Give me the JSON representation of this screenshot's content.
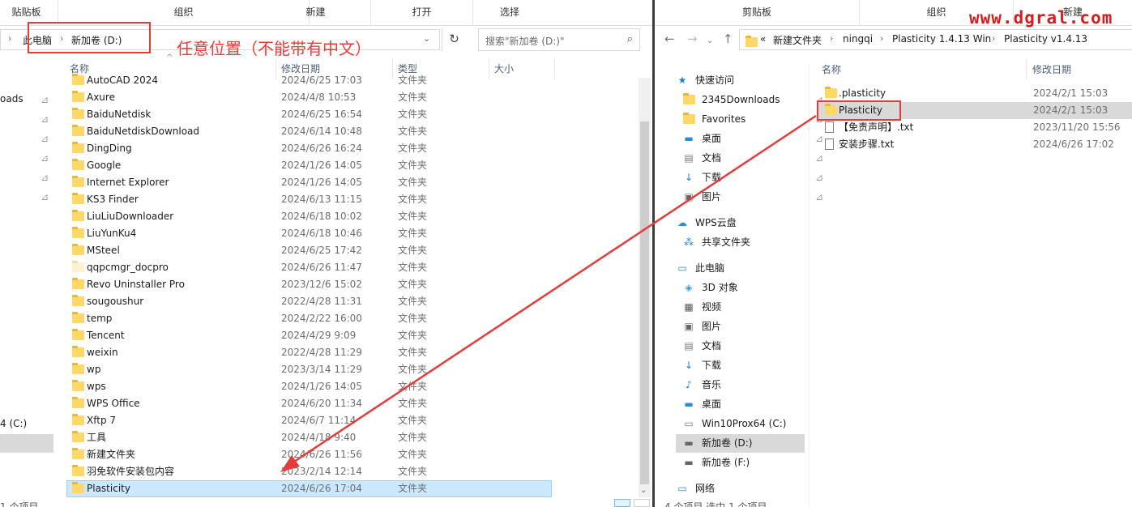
{
  "left": {
    "ribbon": {
      "clipboard_partial": "贴贴板",
      "organize": "组织",
      "new": "新建",
      "open": "打开",
      "select": "选择"
    },
    "address": {
      "crumb1": "此电脑",
      "crumb2": "新加卷 (D:)"
    },
    "search_placeholder": "搜索\"新加卷 (D:)\"",
    "columns": {
      "name": "名称",
      "date": "修改日期",
      "type": "类型",
      "size": "大小"
    },
    "nav_partial": {
      "downloads": "oads",
      "drive": "4 (C:)"
    },
    "status_partial": "1 个项目",
    "files": [
      {
        "name": "AutoCAD 2024",
        "date": "2024/6/25 17:03",
        "type": "文件夹"
      },
      {
        "name": "Axure",
        "date": "2024/4/8 10:53",
        "type": "文件夹"
      },
      {
        "name": "BaiduNetdisk",
        "date": "2024/6/25 16:54",
        "type": "文件夹"
      },
      {
        "name": "BaiduNetdiskDownload",
        "date": "2024/6/14 10:48",
        "type": "文件夹"
      },
      {
        "name": "DingDing",
        "date": "2024/6/26 16:24",
        "type": "文件夹"
      },
      {
        "name": "Google",
        "date": "2024/1/26 14:05",
        "type": "文件夹"
      },
      {
        "name": "Internet Explorer",
        "date": "2024/1/26 14:05",
        "type": "文件夹"
      },
      {
        "name": "KS3 Finder",
        "date": "2024/6/13 11:15",
        "type": "文件夹"
      },
      {
        "name": "LiuLiuDownloader",
        "date": "2024/6/18 10:02",
        "type": "文件夹"
      },
      {
        "name": "LiuYunKu4",
        "date": "2024/6/18 10:46",
        "type": "文件夹"
      },
      {
        "name": "MSteel",
        "date": "2024/6/25 17:42",
        "type": "文件夹"
      },
      {
        "name": "qqpcmgr_docpro",
        "date": "2024/6/26 11:47",
        "type": "文件夹"
      },
      {
        "name": "Revo Uninstaller Pro",
        "date": "2023/12/6 15:02",
        "type": "文件夹"
      },
      {
        "name": "sougoushur",
        "date": "2022/4/28 11:31",
        "type": "文件夹"
      },
      {
        "name": "temp",
        "date": "2024/2/22 16:00",
        "type": "文件夹"
      },
      {
        "name": "Tencent",
        "date": "2024/4/29 9:09",
        "type": "文件夹"
      },
      {
        "name": "weixin",
        "date": "2022/4/28 11:29",
        "type": "文件夹"
      },
      {
        "name": "wp",
        "date": "2023/3/14 11:29",
        "type": "文件夹"
      },
      {
        "name": "wps",
        "date": "2024/1/26 14:05",
        "type": "文件夹"
      },
      {
        "name": "WPS Office",
        "date": "2024/6/20 11:34",
        "type": "文件夹"
      },
      {
        "name": "Xftp 7",
        "date": "2024/6/7 11:14",
        "type": "文件夹"
      },
      {
        "name": "工具",
        "date": "2024/4/18 9:40",
        "type": "文件夹"
      },
      {
        "name": "新建文件夹",
        "date": "2024/6/26 11:56",
        "type": "文件夹"
      },
      {
        "name": "羽免软件安装包内容",
        "date": "2023/2/14 12:14",
        "type": "文件夹"
      },
      {
        "name": "Plasticity",
        "date": "2024/6/26 17:04",
        "type": "文件夹"
      }
    ]
  },
  "right": {
    "ribbon": {
      "clipboard": "剪贴板",
      "organize": "组织",
      "new_partial": "新建"
    },
    "address": {
      "overflow": "«",
      "crumb1": "新建文件夹",
      "crumb2": "ningqi",
      "crumb3": "Plasticity 1.4.13 Win",
      "crumb4": "Plasticity v1.4.13"
    },
    "columns": {
      "name": "名称",
      "date": "修改日期"
    },
    "nav": {
      "quick_access": "快速访问",
      "qa_items": [
        "2345Downloads",
        "Favorites",
        "桌面",
        "文档",
        "下载",
        "图片"
      ],
      "wps_cloud": "WPS云盘",
      "shared": "共享文件夹",
      "this_pc": "此电脑",
      "pc_items": [
        "3D 对象",
        "视频",
        "图片",
        "文档",
        "下载",
        "音乐",
        "桌面",
        "Win10Prox64 (C:)",
        "新加卷 (D:)",
        "新加卷 (F:)"
      ],
      "network": "网络"
    },
    "files": [
      {
        "name": ".plasticity",
        "date": "2024/2/1 15:03"
      },
      {
        "name": "Plasticity",
        "date": "2024/2/1 15:03"
      },
      {
        "name": "【免责声明】.txt",
        "date": "2023/11/20 15:56"
      },
      {
        "name": "安装步骤.txt",
        "date": "2024/6/26 17:02"
      }
    ],
    "status_partial": "4 个项目    选中 1 个项目"
  },
  "annotation": {
    "text": "任意位置（不能带有中文）",
    "watermark": "www.dgral.com",
    "color": "#e43c3c"
  }
}
